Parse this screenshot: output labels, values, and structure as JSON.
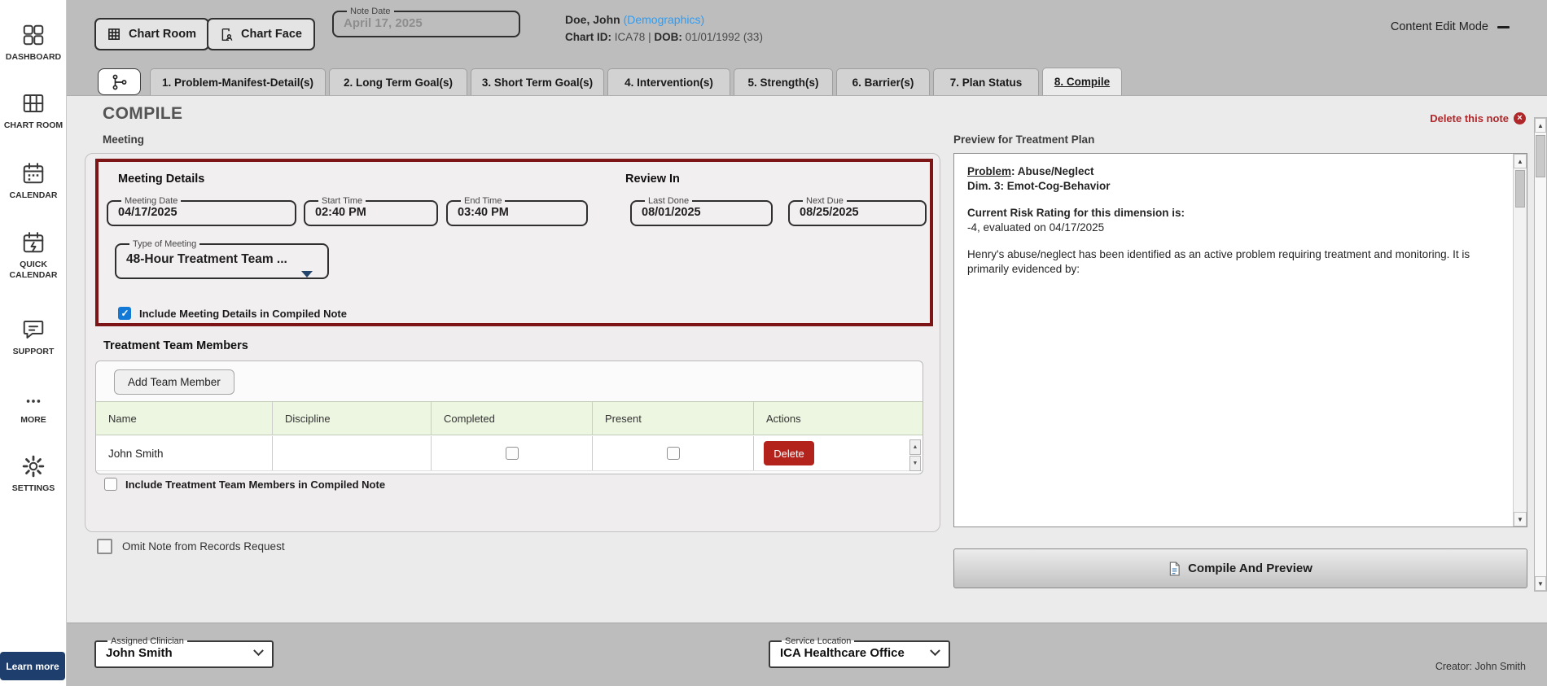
{
  "sidebar": {
    "items": [
      {
        "label": "DASHBOARD",
        "icon": "dashboard-grid-icon"
      },
      {
        "label": "CHART ROOM",
        "icon": "chart-room-icon"
      },
      {
        "label": "CALENDAR",
        "icon": "calendar-icon"
      },
      {
        "label": "QUICK CALENDAR",
        "icon": "quick-calendar-icon"
      },
      {
        "label": "SUPPORT",
        "icon": "support-chat-icon"
      },
      {
        "label": "MORE",
        "icon": "more-dots-icon"
      },
      {
        "label": "SETTINGS",
        "icon": "settings-gear-icon"
      }
    ],
    "learn_more": "Learn more"
  },
  "header": {
    "chart_room_button": "Chart Room",
    "chart_face_button": "Chart Face",
    "note_date": {
      "label": "Note Date",
      "value": "April 17, 2025"
    },
    "patient": {
      "name": "Doe, John",
      "demographics_link": "(Demographics)",
      "chart_id_label": "Chart ID:",
      "chart_id_value": "ICA78",
      "separator": "|",
      "dob_label": "DOB:",
      "dob_value": "01/01/1992 (33)"
    },
    "content_edit_mode": "Content Edit Mode"
  },
  "tabs": [
    {
      "label": "1. Problem-Manifest-Detail(s)",
      "active": false
    },
    {
      "label": "2. Long Term Goal(s)",
      "active": false
    },
    {
      "label": "3. Short Term Goal(s)",
      "active": false
    },
    {
      "label": "4. Intervention(s)",
      "active": false
    },
    {
      "label": "5. Strength(s)",
      "active": false
    },
    {
      "label": "6. Barrier(s)",
      "active": false
    },
    {
      "label": "7. Plan Status",
      "active": false
    },
    {
      "label": "8. Compile",
      "active": true
    }
  ],
  "compile": {
    "title": "COMPILE",
    "delete_note": "Delete this note",
    "meeting_label": "Meeting",
    "meeting_details": {
      "title": "Meeting Details",
      "review_in_title": "Review In",
      "meeting_date": {
        "label": "Meeting Date",
        "value": "04/17/2025"
      },
      "start_time": {
        "label": "Start Time",
        "value": "02:40 PM"
      },
      "end_time": {
        "label": "End Time",
        "value": "03:40 PM"
      },
      "last_done": {
        "label": "Last Done",
        "value": "08/01/2025"
      },
      "next_due": {
        "label": "Next Due",
        "value": "08/25/2025"
      },
      "type_of_meeting": {
        "label": "Type of Meeting",
        "value": "48-Hour Treatment Team ..."
      },
      "include_label": "Include Meeting Details in Compiled Note",
      "include_checked": true
    },
    "team": {
      "title": "Treatment Team Members",
      "add_button": "Add Team Member",
      "columns": [
        "Name",
        "Discipline",
        "Completed",
        "Present",
        "Actions"
      ],
      "row": {
        "name": "John Smith",
        "discipline": "",
        "completed": false,
        "present": false,
        "delete_label": "Delete"
      },
      "include_label": "Include Treatment Team Members in Compiled Note",
      "include_checked": false
    },
    "omit_label": "Omit Note from Records Request",
    "omit_checked": false
  },
  "preview": {
    "title": "Preview for Treatment Plan",
    "problem_label": "Problem",
    "problem_rest": ": Abuse/Neglect",
    "dim_line": "Dim. 3: Emot-Cog-Behavior",
    "risk_heading": "Current Risk Rating for this dimension is:",
    "risk_value": "-4, evaluated on 04/17/2025",
    "body": "Henry's abuse/neglect has been identified as an active problem requiring treatment and monitoring. It is primarily evidenced by:",
    "compile_button": "Compile And Preview"
  },
  "footer": {
    "assigned_clinician": {
      "label": "Assigned Clinician",
      "value": "John Smith"
    },
    "service_location": {
      "label": "Service Location",
      "value": "ICA Healthcare Office"
    },
    "creator": "Creator: John Smith"
  },
  "colors": {
    "header_gray": "#bdbdbd",
    "content_bg": "#ebebeb",
    "alert_red_border": "#7d1517",
    "delete_red": "#b3231c",
    "checkbox_blue": "#1279d6",
    "link_blue": "#2e9cf4",
    "learn_more_navy": "#1e3e6e",
    "table_header_green": "#edf6e1"
  }
}
